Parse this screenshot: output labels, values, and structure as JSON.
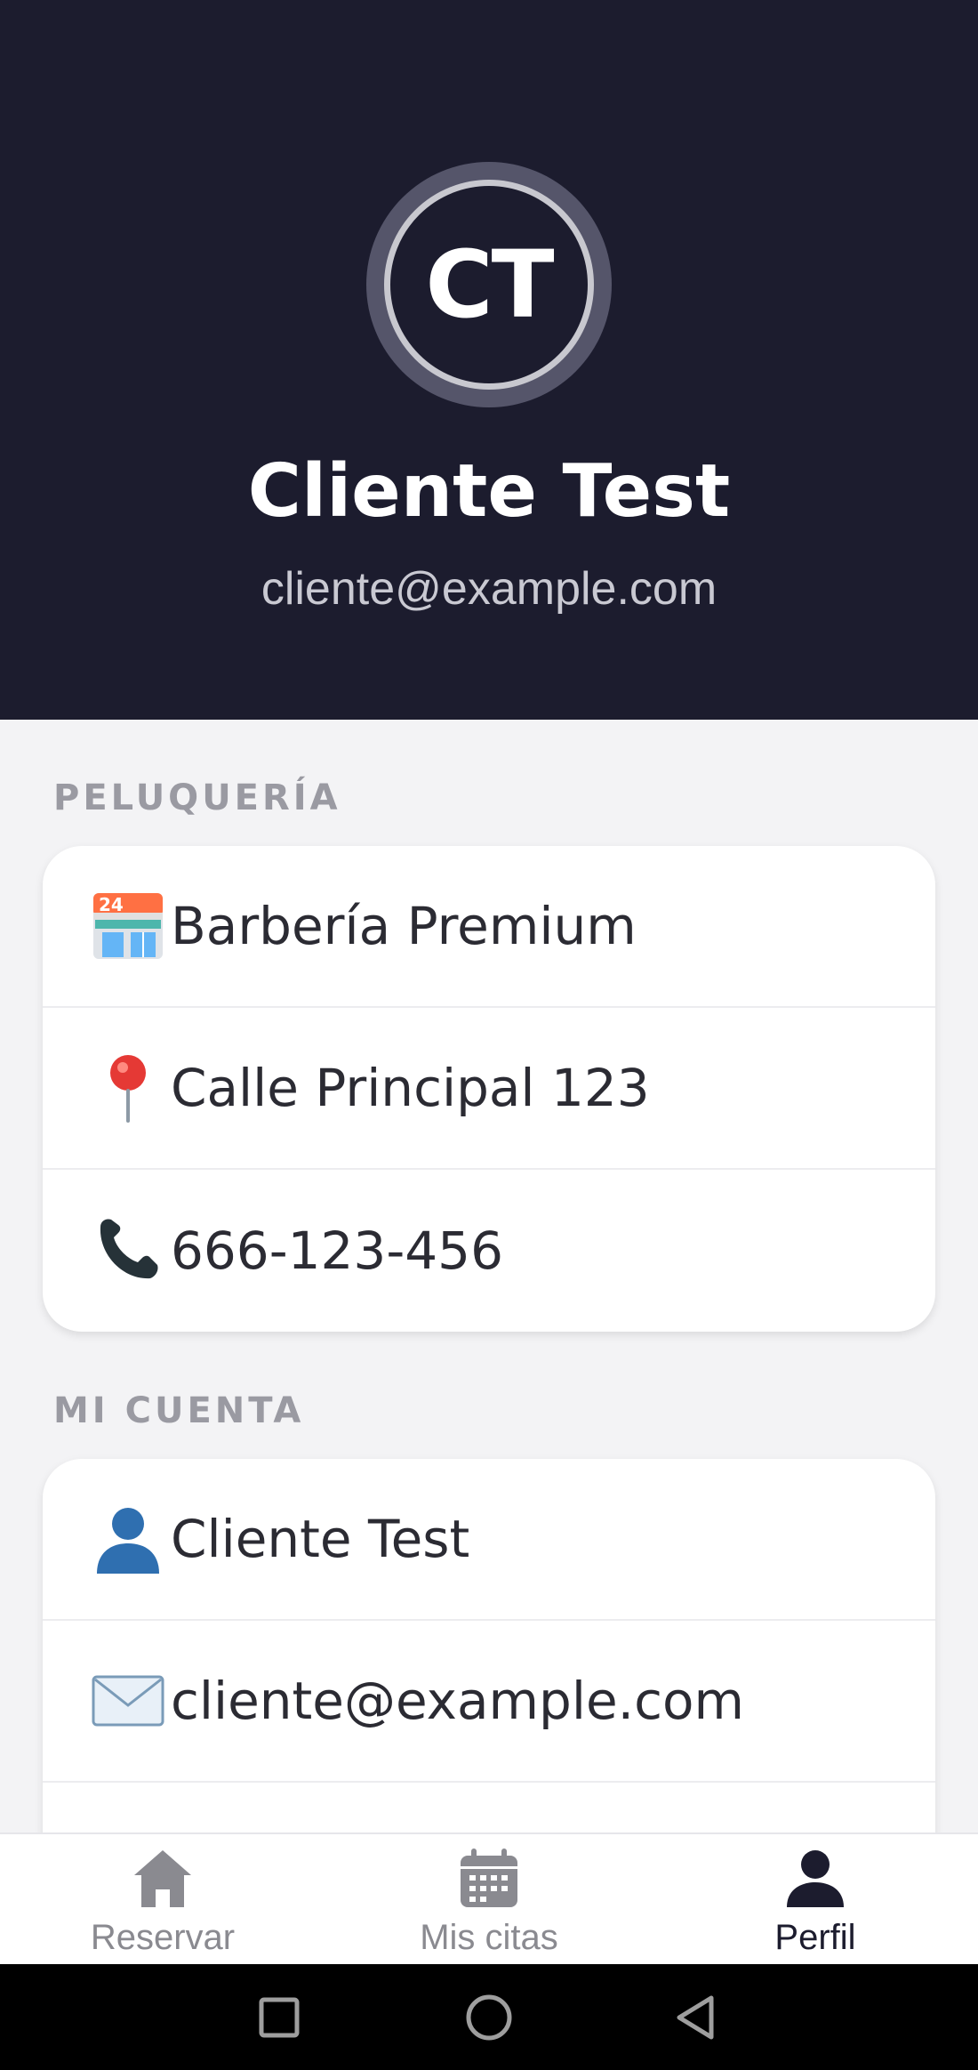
{
  "header": {
    "avatar_initials": "CT",
    "name": "Cliente Test",
    "email": "cliente@example.com"
  },
  "sections": {
    "salon": {
      "title": "PELUQUERÍA",
      "items": [
        {
          "icon": "store-icon",
          "label": "Barbería Premium"
        },
        {
          "icon": "location-pin-icon",
          "label": "Calle Principal 123"
        },
        {
          "icon": "phone-icon",
          "label": "666-123-456"
        }
      ]
    },
    "account": {
      "title": "MI CUENTA",
      "items": [
        {
          "icon": "user-icon",
          "label": "Cliente Test"
        },
        {
          "icon": "envelope-icon",
          "label": "cliente@example.com"
        }
      ]
    }
  },
  "bottom_nav": {
    "items": [
      {
        "icon": "home-icon",
        "label": "Reservar",
        "active": false
      },
      {
        "icon": "calendar-icon",
        "label": "Mis citas",
        "active": false
      },
      {
        "icon": "person-icon",
        "label": "Perfil",
        "active": true
      }
    ]
  },
  "system_nav": {
    "buttons": [
      "recents-icon",
      "home-circle-icon",
      "back-icon"
    ]
  },
  "colors": {
    "header_bg": "#1c1c2e",
    "page_bg": "#f3f3f5",
    "active_nav": "#1c1c2e",
    "inactive_nav": "#8a8a90"
  }
}
